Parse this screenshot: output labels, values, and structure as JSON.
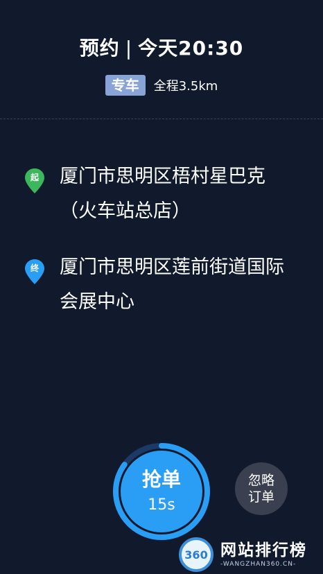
{
  "header": {
    "order_type": "预约",
    "separator": "|",
    "time": "今天20:30",
    "car_type": "专车",
    "distance": "全程3.5km"
  },
  "route": {
    "start": {
      "pin_label": "起",
      "address": "厦门市思明区梧村星巴克（火车站总店）"
    },
    "end": {
      "pin_label": "终",
      "address": "厦门市思明区莲前街道国际会展中心"
    }
  },
  "actions": {
    "grab_label": "抢单",
    "grab_countdown": "15s",
    "countdown_progress": 0.85,
    "ignore_line1": "忽略",
    "ignore_line2": "订单"
  },
  "watermark": {
    "logo_text": "360",
    "name": "网站排行榜",
    "url": "-WANGZHAN360.CN-"
  },
  "colors": {
    "background": "#111a2d",
    "start_pin": "#3cb85c",
    "end_pin": "#2a9df4",
    "grab_button": "#2a9df4",
    "car_badge": "#8aa3d6"
  }
}
